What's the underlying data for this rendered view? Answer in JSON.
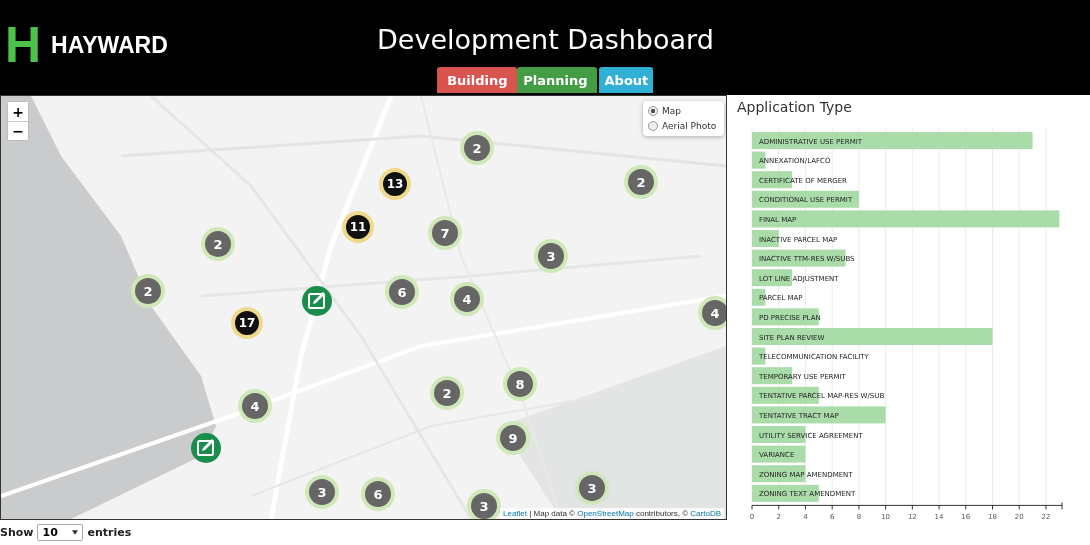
{
  "header": {
    "logo_letter": "H",
    "logo_text": "HAYWARD",
    "title": "Development Dashboard"
  },
  "tabs": [
    {
      "label": "Building",
      "color": "#d9534f",
      "selected": false
    },
    {
      "label": "Planning",
      "color": "#449d44",
      "selected": true
    },
    {
      "label": "About",
      "color": "#31b0d5",
      "selected": false
    }
  ],
  "map": {
    "zoom_in": "+",
    "zoom_out": "−",
    "layers": [
      {
        "label": "Map",
        "selected": true
      },
      {
        "label": "Aerial Photo",
        "selected": false
      }
    ],
    "markers": [
      {
        "kind": "cluster",
        "count": "2"
      },
      {
        "kind": "large",
        "count": "13"
      },
      {
        "kind": "cluster",
        "count": "2"
      },
      {
        "kind": "cluster",
        "count": "2"
      },
      {
        "kind": "large",
        "count": "11"
      },
      {
        "kind": "cluster",
        "count": "7"
      },
      {
        "kind": "cluster",
        "count": "3"
      },
      {
        "kind": "cluster",
        "count": "2"
      },
      {
        "kind": "edit"
      },
      {
        "kind": "cluster",
        "count": "6"
      },
      {
        "kind": "cluster",
        "count": "4"
      },
      {
        "kind": "cluster",
        "count": "4"
      },
      {
        "kind": "large",
        "count": "17"
      },
      {
        "kind": "cluster",
        "count": "4"
      },
      {
        "kind": "cluster",
        "count": "2"
      },
      {
        "kind": "cluster",
        "count": "8"
      },
      {
        "kind": "edit"
      },
      {
        "kind": "cluster",
        "count": "9"
      },
      {
        "kind": "cluster",
        "count": "3"
      },
      {
        "kind": "cluster",
        "count": "6"
      },
      {
        "kind": "cluster",
        "count": "3"
      },
      {
        "kind": "cluster",
        "count": "3"
      }
    ],
    "attribution": {
      "link_1": "Leaflet",
      "text_1": " | Map data © ",
      "link_2": "OpenStreetMap",
      "text_2": " contributors, © ",
      "link_3": "CartoDB"
    }
  },
  "panel": {
    "title": "Application Type",
    "chart_data": {
      "type": "bar",
      "orientation": "horizontal",
      "grid": true,
      "categories": [
        "ADMINISTRATIVE USE PERMIT",
        "ANNEXATION/LAFCO",
        "CERTIFICATE OF MERGER",
        "CONDITIONAL USE PERMIT",
        "FINAL MAP",
        "INACTIVE PARCEL MAP",
        "INACTIVE TTM-RES W/SUBS",
        "LOT LINE ADJUSTMENT",
        "PARCEL MAP",
        "PD PRECISE PLAN",
        "SITE PLAN REVIEW",
        "TELECOMMUNICATION FACILITY",
        "TEMPORARY USE PERMIT",
        "TENTATIVE PARCEL MAP-RES W/SUB",
        "TENTATIVE TRACT MAP",
        "UTILITY SERVICE AGREEMENT",
        "VARIANCE",
        "ZONING MAP AMENDMENT",
        "ZONING TEXT AMENDMENT"
      ],
      "series": [
        {
          "color": "#a9dca9",
          "values": [
            21,
            1,
            3,
            8,
            23,
            2,
            7,
            3,
            1,
            5,
            18,
            1,
            3,
            5,
            10,
            4,
            4,
            4,
            5
          ]
        }
      ],
      "xlim": [
        0,
        23.2
      ],
      "xticks": [
        0,
        2,
        4,
        6,
        8,
        10,
        12,
        14,
        16,
        18,
        20,
        22
      ]
    }
  },
  "table_controls": {
    "show_label": "Show",
    "page_size": "10",
    "entries_label": "entries"
  }
}
